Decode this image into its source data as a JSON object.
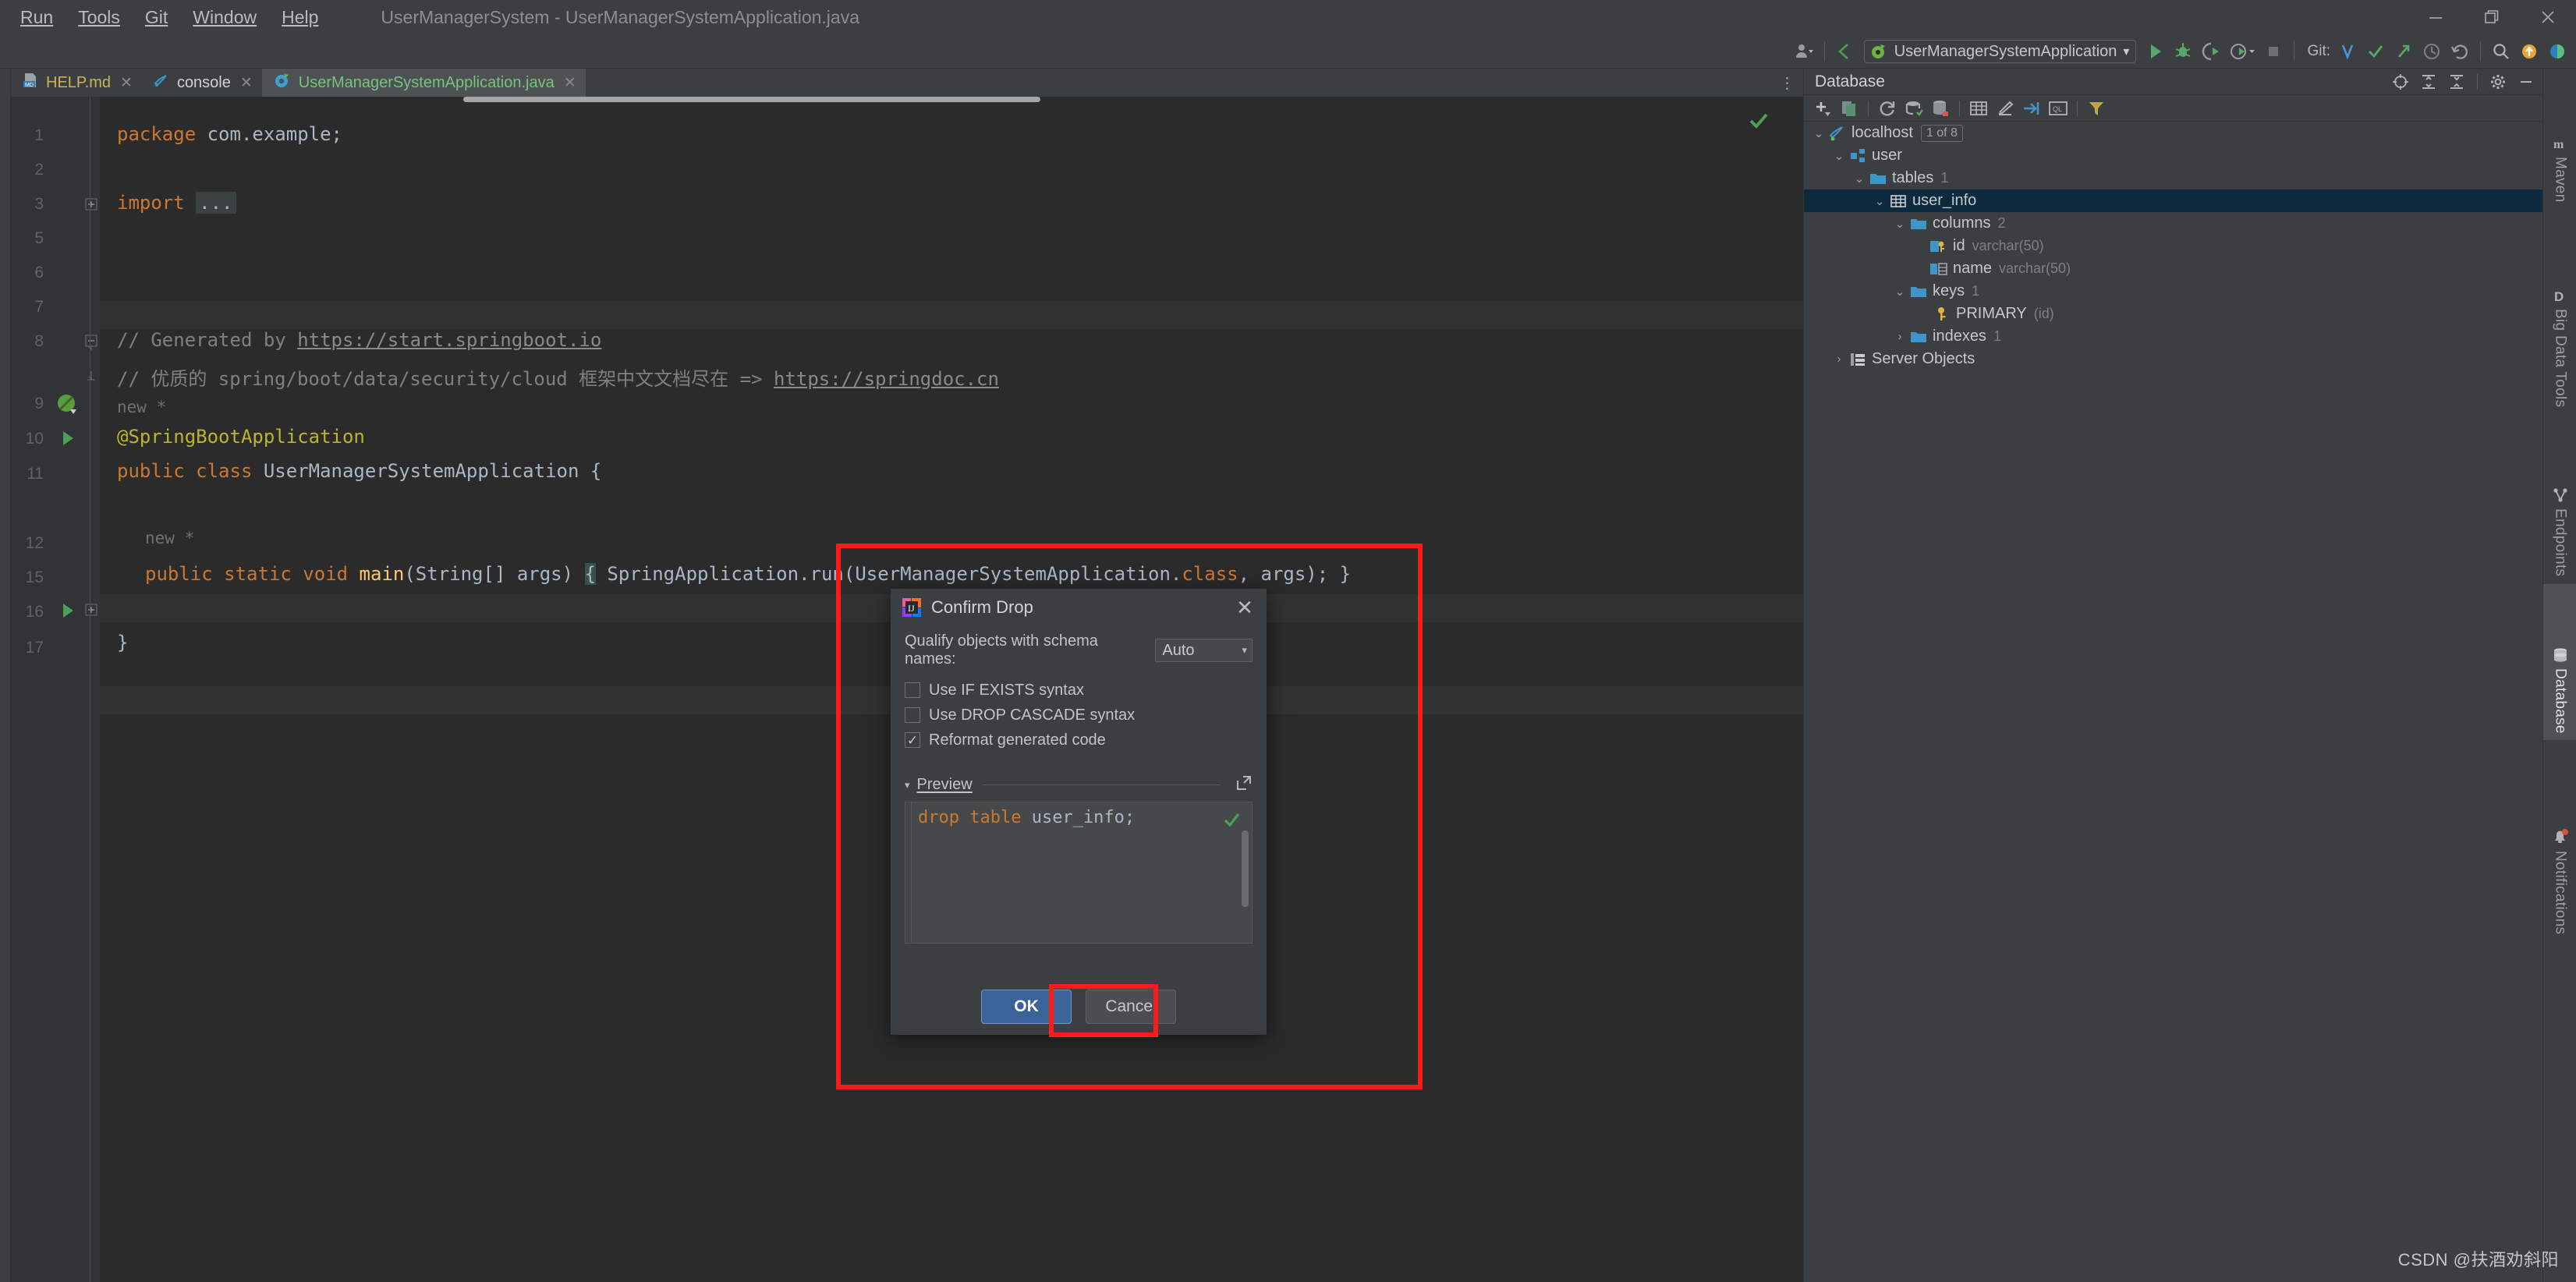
{
  "window": {
    "title": "UserManagerSystem - UserManagerSystemApplication.java",
    "minimize_label": "—",
    "restore_label": "❐",
    "close_label": "✕"
  },
  "menubar": {
    "items": [
      {
        "label": "Run"
      },
      {
        "label": "Tools"
      },
      {
        "label": "Git"
      },
      {
        "label": "Window"
      },
      {
        "label": "Help"
      }
    ]
  },
  "toolbar": {
    "run_config": "UserManagerSystemApplication",
    "run_config_caret": "▾",
    "git_label": "Git:",
    "icons": [
      "user-settings-icon",
      "back-arrow-icon",
      "run-icon",
      "debug-icon",
      "run-with-coverage-icon",
      "profile-icon",
      "stop-icon",
      "git-update-icon",
      "git-commit-icon",
      "git-push-icon",
      "git-history-icon",
      "git-rollback-icon",
      "search-everywhere-icon",
      "notifications-icon",
      "ide-theme-icon"
    ]
  },
  "editor_tabs": [
    {
      "label": "HELP.md",
      "icon": "markdown-file-icon",
      "kind": "md",
      "active": false,
      "close": "✕"
    },
    {
      "label": "console",
      "icon": "mysql-console-icon",
      "kind": "con",
      "active": false,
      "close": "✕"
    },
    {
      "label": "UserManagerSystemApplication.java",
      "icon": "spring-class-icon",
      "kind": "java",
      "active": true,
      "close": "✕"
    }
  ],
  "editor": {
    "tab_overflow_label": "⋮",
    "gutter_numbers": [
      "1",
      "2",
      "3",
      "5",
      "6",
      "7",
      "8",
      "9",
      "10",
      "11",
      "12",
      "15",
      "16",
      "17"
    ],
    "inlay_hints": [
      "new *",
      "new *"
    ],
    "code_lines": [
      {
        "n": "1",
        "segments": [
          {
            "t": "package",
            "c": "kw"
          },
          {
            "t": " com.example;",
            "c": "txt"
          }
        ]
      },
      {
        "n": "3",
        "segments": [
          {
            "t": "import",
            "c": "kw"
          },
          {
            "t": " ",
            "c": "txt"
          },
          {
            "t": "...",
            "c": "fold"
          }
        ]
      },
      {
        "n": "7",
        "segments": [
          {
            "t": "// Generated by ",
            "c": "cmt"
          },
          {
            "t": "https://start.springboot.io",
            "c": "lnk"
          }
        ]
      },
      {
        "n": "8",
        "segments": [
          {
            "t": "// 优质的 spring/boot/data/security/cloud 框架中文文档尽在 => ",
            "c": "cmt"
          },
          {
            "t": "https://springdoc.cn",
            "c": "lnk"
          }
        ]
      },
      {
        "n": "9",
        "segments": [
          {
            "t": "@SpringBootApplication",
            "c": "ann"
          }
        ]
      },
      {
        "n": "10",
        "segments": [
          {
            "t": "public class",
            "c": "kw"
          },
          {
            "t": " UserManagerSystemApplication {",
            "c": "txt"
          }
        ]
      },
      {
        "n": "12",
        "segments": [
          {
            "t": "public static void",
            "c": "kw"
          },
          {
            "t": " ",
            "c": "txt"
          },
          {
            "t": "main",
            "c": "fn"
          },
          {
            "t": "(String[] args) ",
            "c": "txt"
          },
          {
            "t": "{",
            "c": "brace"
          },
          {
            "t": " SpringApplication.run(UserManagerSystemApplication.",
            "c": "txt"
          },
          {
            "t": "class",
            "c": "kw"
          },
          {
            "t": ", args); }",
            "c": "txt"
          }
        ]
      },
      {
        "n": "16",
        "segments": [
          {
            "t": "}",
            "c": "txt"
          }
        ]
      }
    ],
    "inspection_status": "ok-check-icon"
  },
  "database_panel": {
    "title": "Database",
    "header_icons": [
      "locate-icon",
      "expand-all-icon",
      "collapse-all-icon",
      "settings-gear-icon",
      "hide-icon"
    ],
    "toolbar_icons": [
      "add-new-icon",
      "duplicate-icon",
      "refresh-icon",
      "sync-icon",
      "database-diff-icon",
      "table-editor-icon",
      "modify-icon",
      "jump-to-console-icon",
      "query-console-icon",
      "filter-icon"
    ],
    "tree": [
      {
        "indent": 0,
        "arrow": "⌄",
        "icon": "mysql-icon",
        "label": "localhost",
        "badge": "1 of 8",
        "selected": false
      },
      {
        "indent": 1,
        "arrow": "⌄",
        "icon": "schema-icon",
        "label": "user",
        "selected": false
      },
      {
        "indent": 2,
        "arrow": "⌄",
        "icon": "folder-icon",
        "label": "tables",
        "count": "1",
        "selected": false
      },
      {
        "indent": 3,
        "arrow": "⌄",
        "icon": "table-icon",
        "label": "user_info",
        "selected": true
      },
      {
        "indent": 4,
        "arrow": "⌄",
        "icon": "folder-icon",
        "label": "columns",
        "count": "2",
        "selected": false
      },
      {
        "indent": 5,
        "arrow": "",
        "icon": "pk-column-icon",
        "label": "id",
        "type": "varchar(50)",
        "selected": false
      },
      {
        "indent": 5,
        "arrow": "",
        "icon": "column-icon",
        "label": "name",
        "type": "varchar(50)",
        "selected": false
      },
      {
        "indent": 4,
        "arrow": "⌄",
        "icon": "folder-icon",
        "label": "keys",
        "count": "1",
        "selected": false
      },
      {
        "indent": 5,
        "arrow": "",
        "icon": "key-icon",
        "label": "PRIMARY",
        "type": "(id)",
        "selected": false
      },
      {
        "indent": 4,
        "arrow": "›",
        "icon": "folder-icon",
        "label": "indexes",
        "count": "1",
        "selected": false
      },
      {
        "indent": 1,
        "arrow": "›",
        "icon": "server-objects-icon",
        "label": "Server Objects",
        "selected": false
      }
    ]
  },
  "right_tool_strip": [
    {
      "label": "Maven",
      "icon": "maven-icon",
      "active": false
    },
    {
      "label": "Big Data Tools",
      "icon": "big-data-tools-icon",
      "active": false
    },
    {
      "label": "Endpoints",
      "icon": "endpoints-icon",
      "active": false
    },
    {
      "label": "Database",
      "icon": "database-icon",
      "active": true
    },
    {
      "label": "Notifications",
      "icon": "notifications-bell-icon",
      "active": false
    }
  ],
  "dialog": {
    "title": "Confirm Drop",
    "icon": "intellij-idea-icon",
    "close": "✕",
    "qualify_label": "Qualify objects with schema names:",
    "qualify_value": "Auto",
    "qualify_arrow": "▾",
    "checkboxes": [
      {
        "label": "Use IF EXISTS syntax",
        "checked": false
      },
      {
        "label": "Use DROP CASCADE syntax",
        "checked": false
      },
      {
        "label": "Reformat generated code",
        "checked": true
      }
    ],
    "check_glyph": "✓",
    "preview": {
      "label": "Preview",
      "collapse_arrow": "▾",
      "expand_icon": "open-in-editor-icon",
      "sql_keyword_1": "drop",
      "sql_keyword_2": "table",
      "sql_object": " user_info;",
      "valid_icon": "valid-check-icon"
    },
    "ok_label": "OK",
    "cancel_label": "Cancel"
  },
  "annotations": {
    "box_color": "#ff1a1a",
    "highlights": [
      "dialog-region-box",
      "ok-button-box"
    ]
  },
  "watermark": "CSDN @扶酒劝斜阳"
}
